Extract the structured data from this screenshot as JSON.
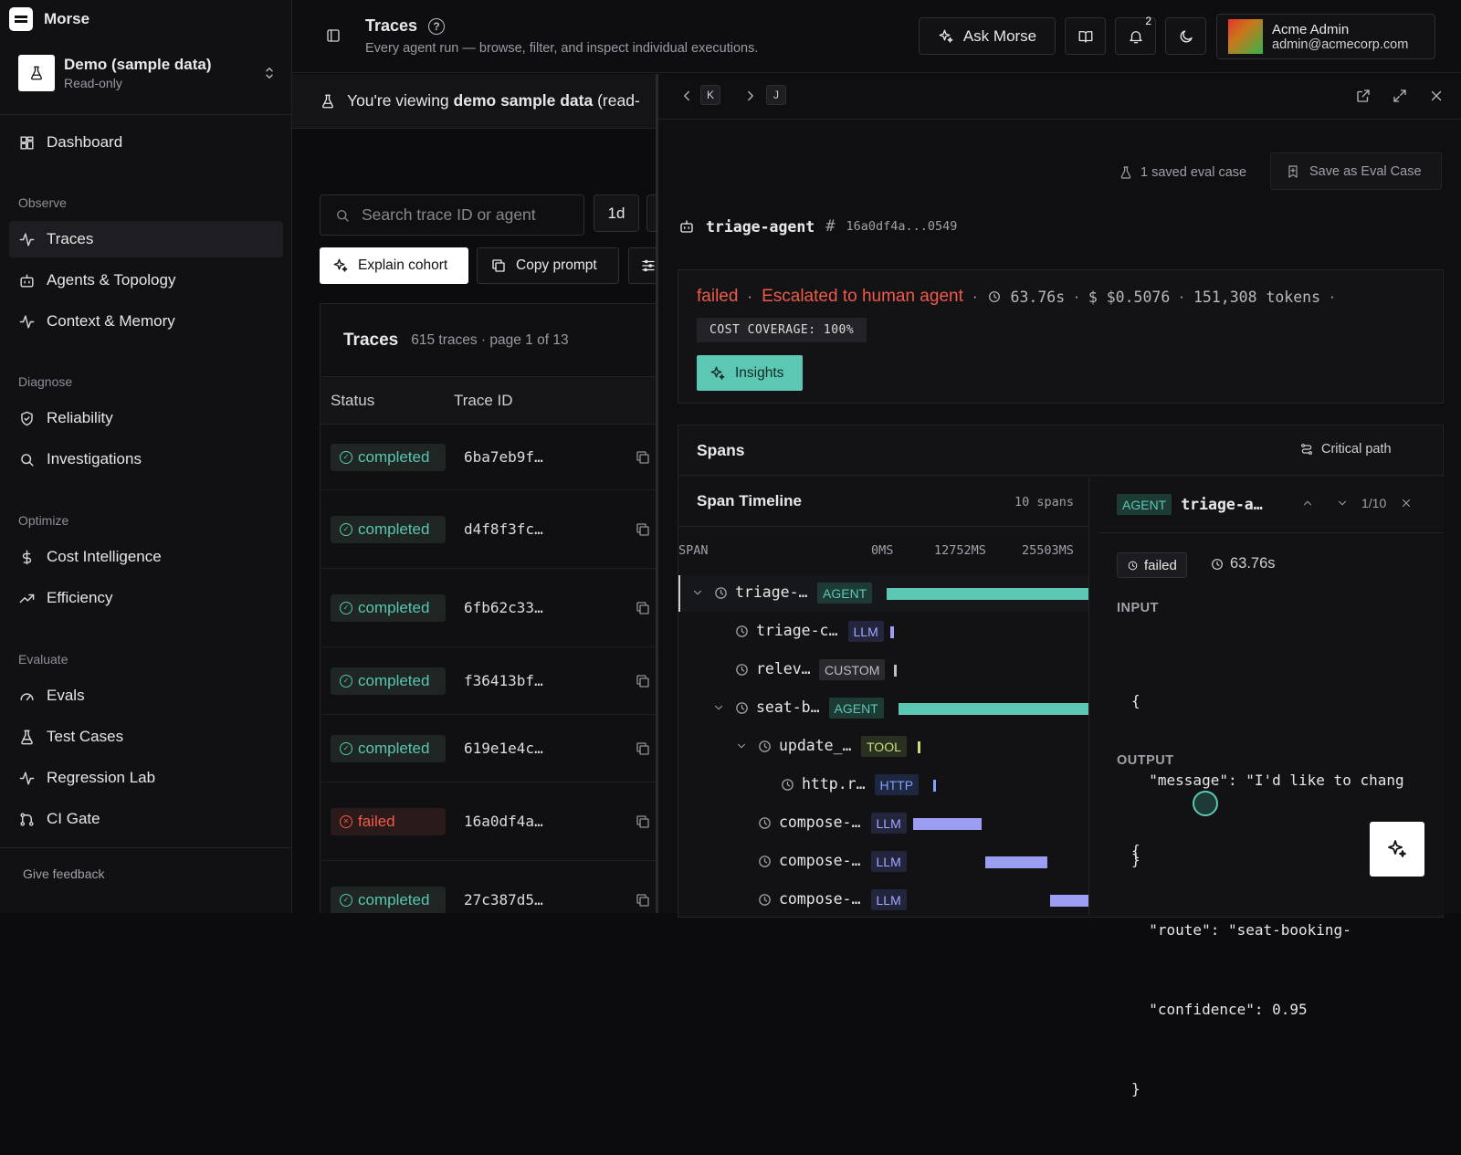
{
  "brand": {
    "name": "Morse"
  },
  "workspace": {
    "name": "Demo (sample data)",
    "mode": "Read-only"
  },
  "sidebar": {
    "dashboard": "Dashboard",
    "groups": {
      "observe": "Observe",
      "diagnose": "Diagnose",
      "optimize": "Optimize",
      "evaluate": "Evaluate"
    },
    "items": {
      "traces": "Traces",
      "agents": "Agents & Topology",
      "context": "Context & Memory",
      "reliability": "Reliability",
      "investigations": "Investigations",
      "cost": "Cost Intelligence",
      "efficiency": "Efficiency",
      "evals": "Evals",
      "test_cases": "Test Cases",
      "regression": "Regression Lab",
      "ci_gate": "CI Gate"
    },
    "feedback": "Give feedback"
  },
  "header": {
    "title": "Traces",
    "subtitle": "Every agent run — browse, filter, and inspect individual executions.",
    "ask": "Ask Morse",
    "notifications": "2",
    "user_name": "Acme Admin",
    "user_email": "admin@acmecorp.com"
  },
  "banner": {
    "prefix": "You're viewing ",
    "bold": "demo sample data",
    "suffix": " (read-"
  },
  "toolbar": {
    "search_placeholder": "Search trace ID or agent",
    "range": "1d",
    "explain": "Explain cohort",
    "copy_prompt": "Copy prompt"
  },
  "traces_table": {
    "title": "Traces",
    "meta": "615 traces · page 1 of 13",
    "columns": [
      "Status",
      "Trace ID"
    ],
    "rows": [
      {
        "status": "completed",
        "id": "6ba7eb9f…"
      },
      {
        "status": "completed",
        "id": "d4f8f3fc…"
      },
      {
        "status": "completed",
        "id": "6fb62c33…"
      },
      {
        "status": "completed",
        "id": "f36413bf…"
      },
      {
        "status": "completed",
        "id": "619e1e4c…"
      },
      {
        "status": "failed",
        "id": "16a0df4a…"
      },
      {
        "status": "completed",
        "id": "27c387d5…"
      }
    ]
  },
  "panel": {
    "kbd_prev": "K",
    "kbd_next": "J",
    "saved_eval": "1 saved eval case",
    "save_eval": "Save as Eval Case",
    "agent": "triage-agent",
    "hash": "16a0df4a...0549",
    "status": "failed",
    "outcome": "Escalated to human agent",
    "duration": "63.76s",
    "cost": "$0.5076",
    "tokens": "151,308 tokens",
    "coverage": "COST COVERAGE: 100%",
    "insights": "Insights"
  },
  "spans": {
    "title": "Spans",
    "critical_path": "Critical path",
    "timeline_title": "Span Timeline",
    "count": "10 spans",
    "col": "SPAN",
    "ticks": [
      "0MS",
      "12752MS",
      "25503MS"
    ],
    "rows": [
      {
        "name": "triage-…",
        "kind": "AGENT",
        "start": 0.0,
        "end": 1.0
      },
      {
        "name": "triage-c…",
        "kind": "LLM",
        "start": 0.0,
        "end": 0.02
      },
      {
        "name": "relev…",
        "kind": "CUSTOM",
        "start": 0.0,
        "end": 0.01
      },
      {
        "name": "seat-b…",
        "kind": "AGENT",
        "start": 0.0,
        "end": 1.0
      },
      {
        "name": "update_…",
        "kind": "TOOL",
        "start": 0.0,
        "end": 0.01
      },
      {
        "name": "http.r…",
        "kind": "HTTP",
        "start": 0.0,
        "end": 0.02
      },
      {
        "name": "compose-…",
        "kind": "LLM",
        "start": 0.0,
        "end": 0.39
      },
      {
        "name": "compose-…",
        "kind": "LLM",
        "start": 0.41,
        "end": 0.76
      },
      {
        "name": "compose-…",
        "kind": "LLM",
        "start": 0.78,
        "end": 1.0
      }
    ]
  },
  "detail": {
    "kind": "AGENT",
    "name": "triage-a…",
    "position": "1/10",
    "status": "failed",
    "duration": "63.76s",
    "input_label": "INPUT",
    "input_lines": [
      "{",
      "  \"message\": \"I'd like to chang",
      "}"
    ],
    "output_label": "OUTPUT",
    "output_lines": [
      "{",
      "  \"route\": \"seat-booking-",
      "  \"confidence\": 0.95",
      "}"
    ]
  }
}
